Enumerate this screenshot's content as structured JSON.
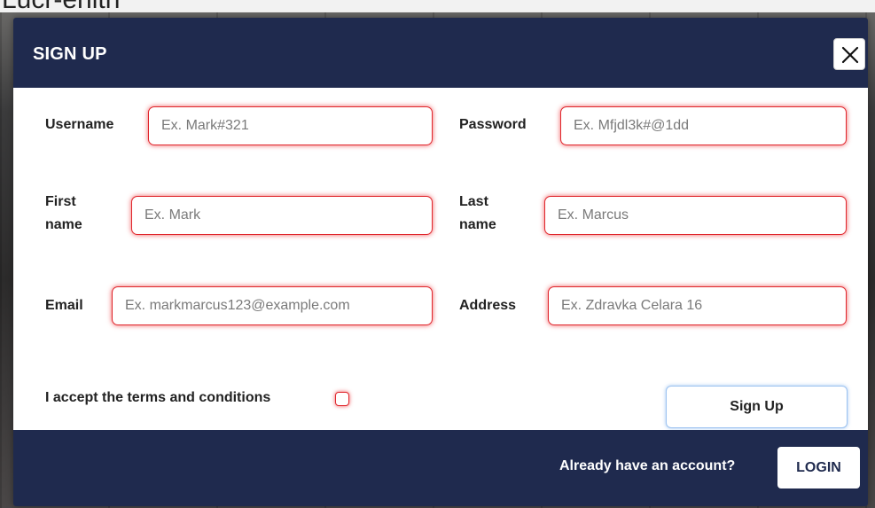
{
  "background": {
    "partial_text": "Lucr-enith"
  },
  "modal": {
    "title": "SIGN UP",
    "close_icon": "close-icon",
    "fields": {
      "username": {
        "label": "Username",
        "placeholder": "Ex. Mark#321",
        "value": ""
      },
      "password": {
        "label": "Password",
        "placeholder": "Ex. Mfjdl3k#@1dd",
        "value": ""
      },
      "first_name": {
        "label": "First name",
        "placeholder": "Ex. Mark",
        "value": ""
      },
      "last_name": {
        "label": "Last name",
        "placeholder": "Ex. Marcus",
        "value": ""
      },
      "email": {
        "label": "Email",
        "placeholder": "Ex. markmarcus123@example.com",
        "value": ""
      },
      "address": {
        "label": "Address",
        "placeholder": "Ex. Zdravka Celara 16",
        "value": ""
      }
    },
    "terms": {
      "label": "I accept the terms and conditions",
      "checked": false
    },
    "signup_label": "Sign Up",
    "footer": {
      "prompt": "Already have an account?",
      "login_label": "LOGIN"
    }
  },
  "colors": {
    "header_bg": "#1f2a4e",
    "invalid_border": "#e0262c",
    "signup_border": "#9cc2f1"
  }
}
